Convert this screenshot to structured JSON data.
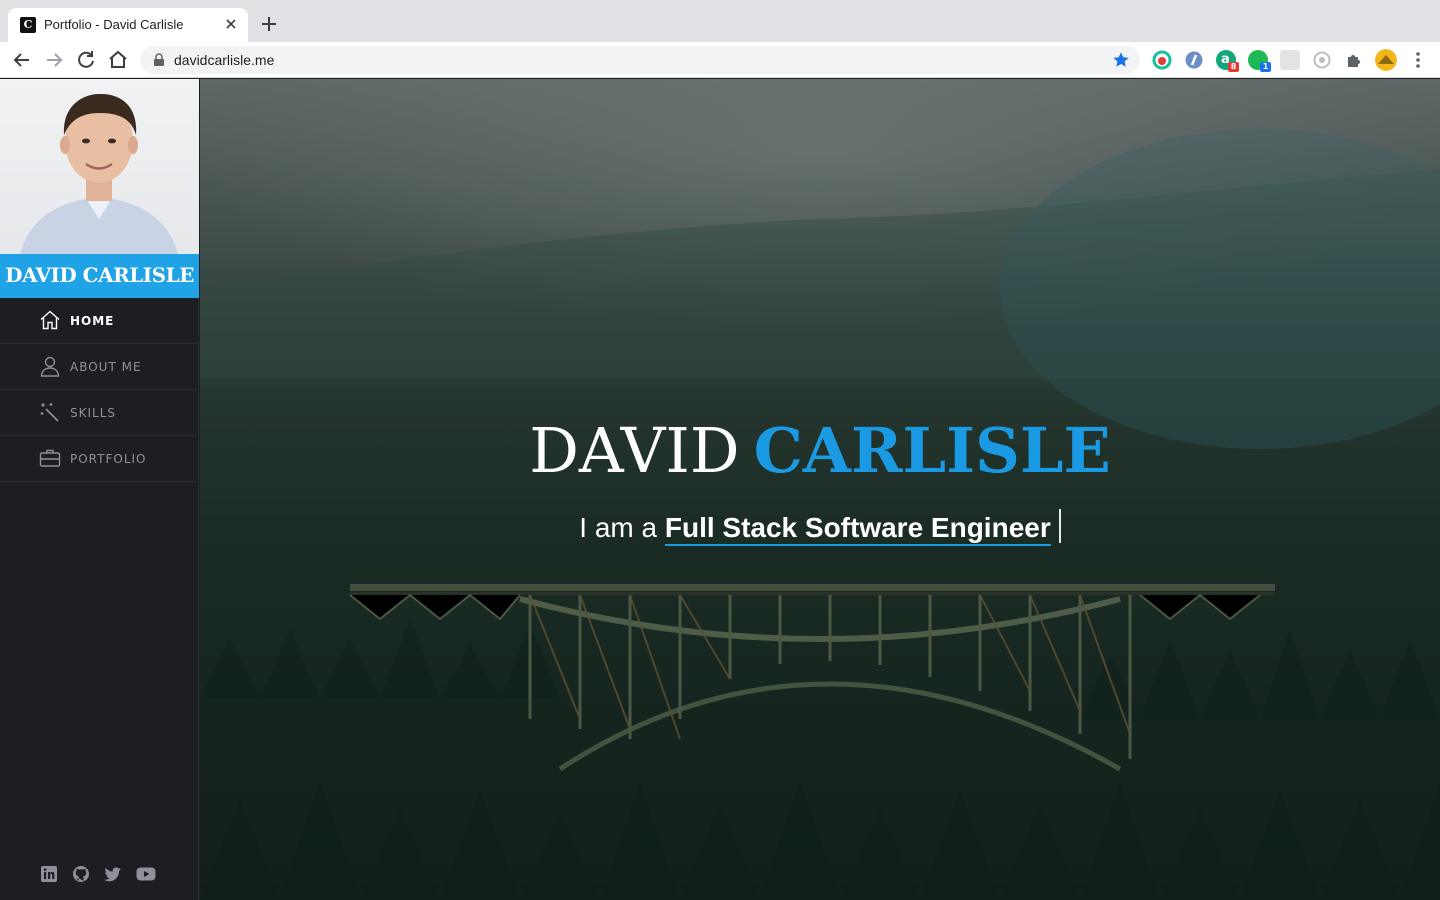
{
  "browser": {
    "tab": {
      "favicon_letter": "C",
      "title": "Portfolio - David Carlisle"
    },
    "url": "davidcarlisle.me",
    "extensions": [
      {
        "icon": "grammarly-like-icon"
      },
      {
        "icon": "compass-icon"
      },
      {
        "icon": "a-extension-icon",
        "badge": "8"
      },
      {
        "icon": "green-dot-extension-icon",
        "badge": "1"
      },
      {
        "icon": "gray-square-extension-icon"
      },
      {
        "icon": "gray-circle-extension-icon"
      },
      {
        "icon": "puzzle-icon"
      },
      {
        "icon": "profile-avatar"
      },
      {
        "icon": "kebab-menu-icon"
      }
    ]
  },
  "sidebar": {
    "name": "DAVID CARLISLE",
    "menu": [
      {
        "label": "HOME",
        "icon": "home-icon",
        "active": true
      },
      {
        "label": "ABOUT ME",
        "icon": "person-icon",
        "active": false
      },
      {
        "label": "SKILLS",
        "icon": "magic-wand-icon",
        "active": false
      },
      {
        "label": "PORTFOLIO",
        "icon": "briefcase-icon",
        "active": false
      }
    ],
    "socials": [
      "linkedin-icon",
      "github-icon",
      "twitter-icon",
      "youtube-icon"
    ]
  },
  "hero": {
    "first_name": "DAVID",
    "last_name": "CARLISLE",
    "intro": "I am a",
    "role": "Full Stack Software Engineer"
  },
  "colors": {
    "accent": "#1b9ae4",
    "banner": "#1fa2e6",
    "sidebar_bg": "#1c1e22"
  }
}
